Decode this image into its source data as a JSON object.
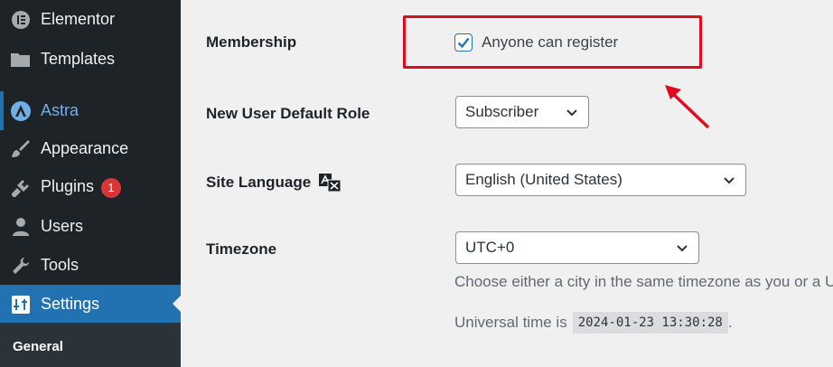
{
  "sidebar": {
    "items": [
      {
        "label": "Elementor"
      },
      {
        "label": "Templates"
      },
      {
        "label": "Astra"
      },
      {
        "label": "Appearance"
      },
      {
        "label": "Plugins",
        "badge": "1"
      },
      {
        "label": "Users"
      },
      {
        "label": "Tools"
      },
      {
        "label": "Settings"
      }
    ],
    "submenu": {
      "current": "General"
    }
  },
  "form": {
    "membership": {
      "label": "Membership",
      "checkbox_label": "Anyone can register",
      "checked": true
    },
    "default_role": {
      "label": "New User Default Role",
      "value": "Subscriber"
    },
    "site_language": {
      "label": "Site Language",
      "value": "English (United States)"
    },
    "timezone": {
      "label": "Timezone",
      "value": "UTC+0",
      "description": "Choose either a city in the same timezone as you or a U",
      "universal_prefix": "Universal time is",
      "universal_time": "2024-01-23 13:30:28",
      "universal_suffix": "."
    }
  },
  "colors": {
    "sidebar_bg": "#1d2327",
    "accent": "#2271b1",
    "highlight": "#e10b1d",
    "badge": "#d63638"
  }
}
